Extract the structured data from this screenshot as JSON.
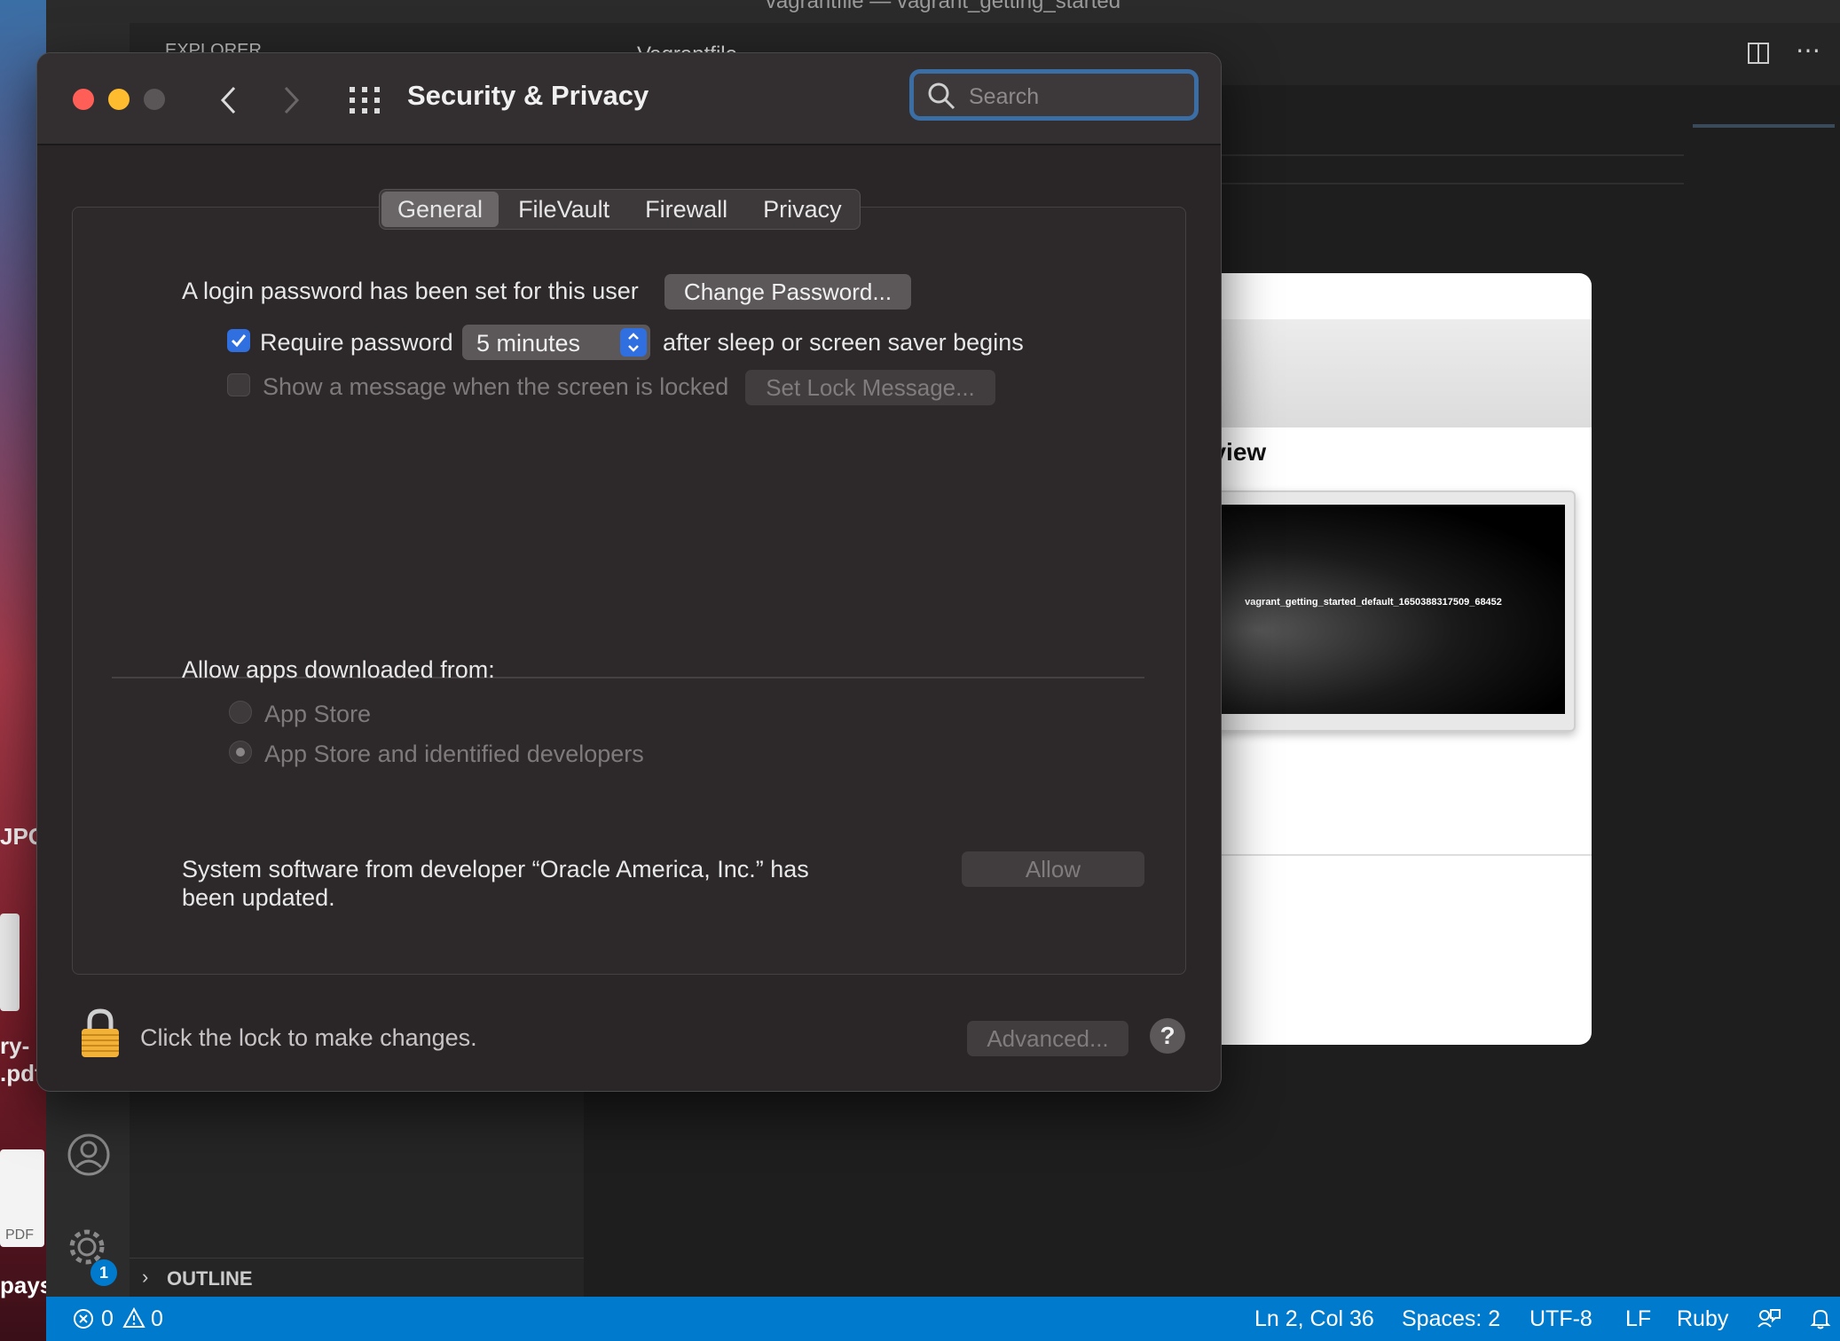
{
  "vscode": {
    "window_title": "vagrantfile — vagrant_getting_started",
    "sidebar_header": "EXPLORER",
    "active_tab": "Vagrantfile",
    "outline_label": "OUTLINE",
    "settings_badge": "1",
    "status": {
      "errors": "0",
      "warnings": "0",
      "position": "Ln 2, Col 36",
      "spaces": "Spaces: 2",
      "encoding": "UTF-8",
      "eol": "LF",
      "language": "Ruby"
    }
  },
  "desktop": {
    "label_jpg": "JPG",
    "label_file_1": "ry-",
    "label_file_2": ".pdf",
    "label_pdf": "PDF",
    "label_pays": "pays"
  },
  "preview": {
    "title": "review",
    "vm_name": "vagrant_getting_started_default_1650388317509_68452"
  },
  "prefs": {
    "title": "Security & Privacy",
    "search_placeholder": "Search",
    "tabs": [
      {
        "label": "General"
      },
      {
        "label": "FileVault"
      },
      {
        "label": "Firewall"
      },
      {
        "label": "Privacy"
      }
    ],
    "password_set_label": "A login password has been set for this user",
    "change_password_button": "Change Password...",
    "require_password_label": "Require password",
    "require_password_checked": true,
    "require_password_value": "5 minutes",
    "after_sleep_label": "after sleep or screen saver begins",
    "show_message_label": "Show a message when the screen is locked",
    "set_lock_message_button": "Set Lock Message...",
    "allow_apps_label": "Allow apps downloaded from:",
    "radio_app_store": "App Store",
    "radio_identified": "App Store and identified developers",
    "system_software_line1": "System software from developer “Oracle America, Inc.” has",
    "system_software_line2": "been updated.",
    "allow_button": "Allow",
    "lock_label": "Click the lock to make changes.",
    "advanced_button": "Advanced...",
    "help_button": "?"
  },
  "colors": {
    "accent": "#007acc",
    "checkbox": "#2f6fe0",
    "traffic_close": "#ff5f57",
    "traffic_minimize": "#febc2e"
  }
}
